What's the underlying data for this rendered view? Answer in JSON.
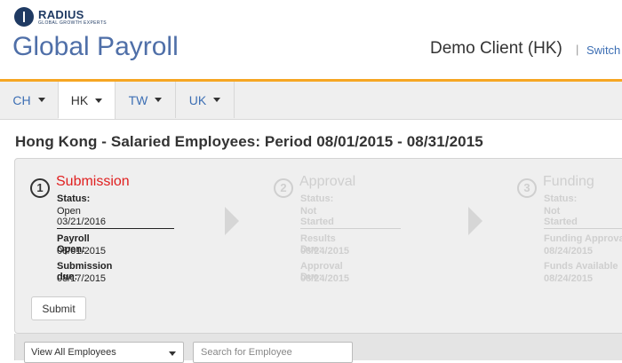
{
  "header": {
    "logo_name": "RADIUS",
    "logo_tagline": "GLOBAL GROWTH EXPERTS",
    "app_title": "Global Payroll",
    "client_name": "Demo Client (HK)",
    "separator": "|",
    "switch_label": "Switch"
  },
  "tabs": [
    {
      "label": "CH",
      "active": false
    },
    {
      "label": "HK",
      "active": true
    },
    {
      "label": "TW",
      "active": false
    },
    {
      "label": "UK",
      "active": false
    }
  ],
  "page_title": "Hong Kong - Salaried Employees: Period 08/01/2015 - 08/31/2015",
  "steps": [
    {
      "number": "1",
      "title": "Submission",
      "status_label": "Status:",
      "status_value": "Open 03/21/2016",
      "field1_label": "Payroll Open:",
      "field1_value": "08/01/2015",
      "field2_label": "Submission due:",
      "field2_value": "08/17/2015"
    },
    {
      "number": "2",
      "title": "Approval",
      "status_label": "Status:",
      "status_value": "Not Started",
      "field1_label": "Results Due:",
      "field1_value": "08/24/2015",
      "field2_label": "Approval Due:",
      "field2_value": "08/24/2015"
    },
    {
      "number": "3",
      "title": "Funding",
      "status_label": "Status:",
      "status_value": "Not Started",
      "field1_label": "Funding Approval",
      "field1_value": "08/24/2015",
      "field2_label": "Funds Available",
      "field2_value": "08/24/2015"
    }
  ],
  "submit_label": "Submit",
  "filter": {
    "employee_select_value": "View All Employees",
    "search_placeholder": "Search for Employee"
  },
  "colors": {
    "brand_blue": "#4f6fa8",
    "accent_orange": "#f6a623",
    "active_step_red": "#e02020",
    "link_blue": "#3d6fb4"
  }
}
